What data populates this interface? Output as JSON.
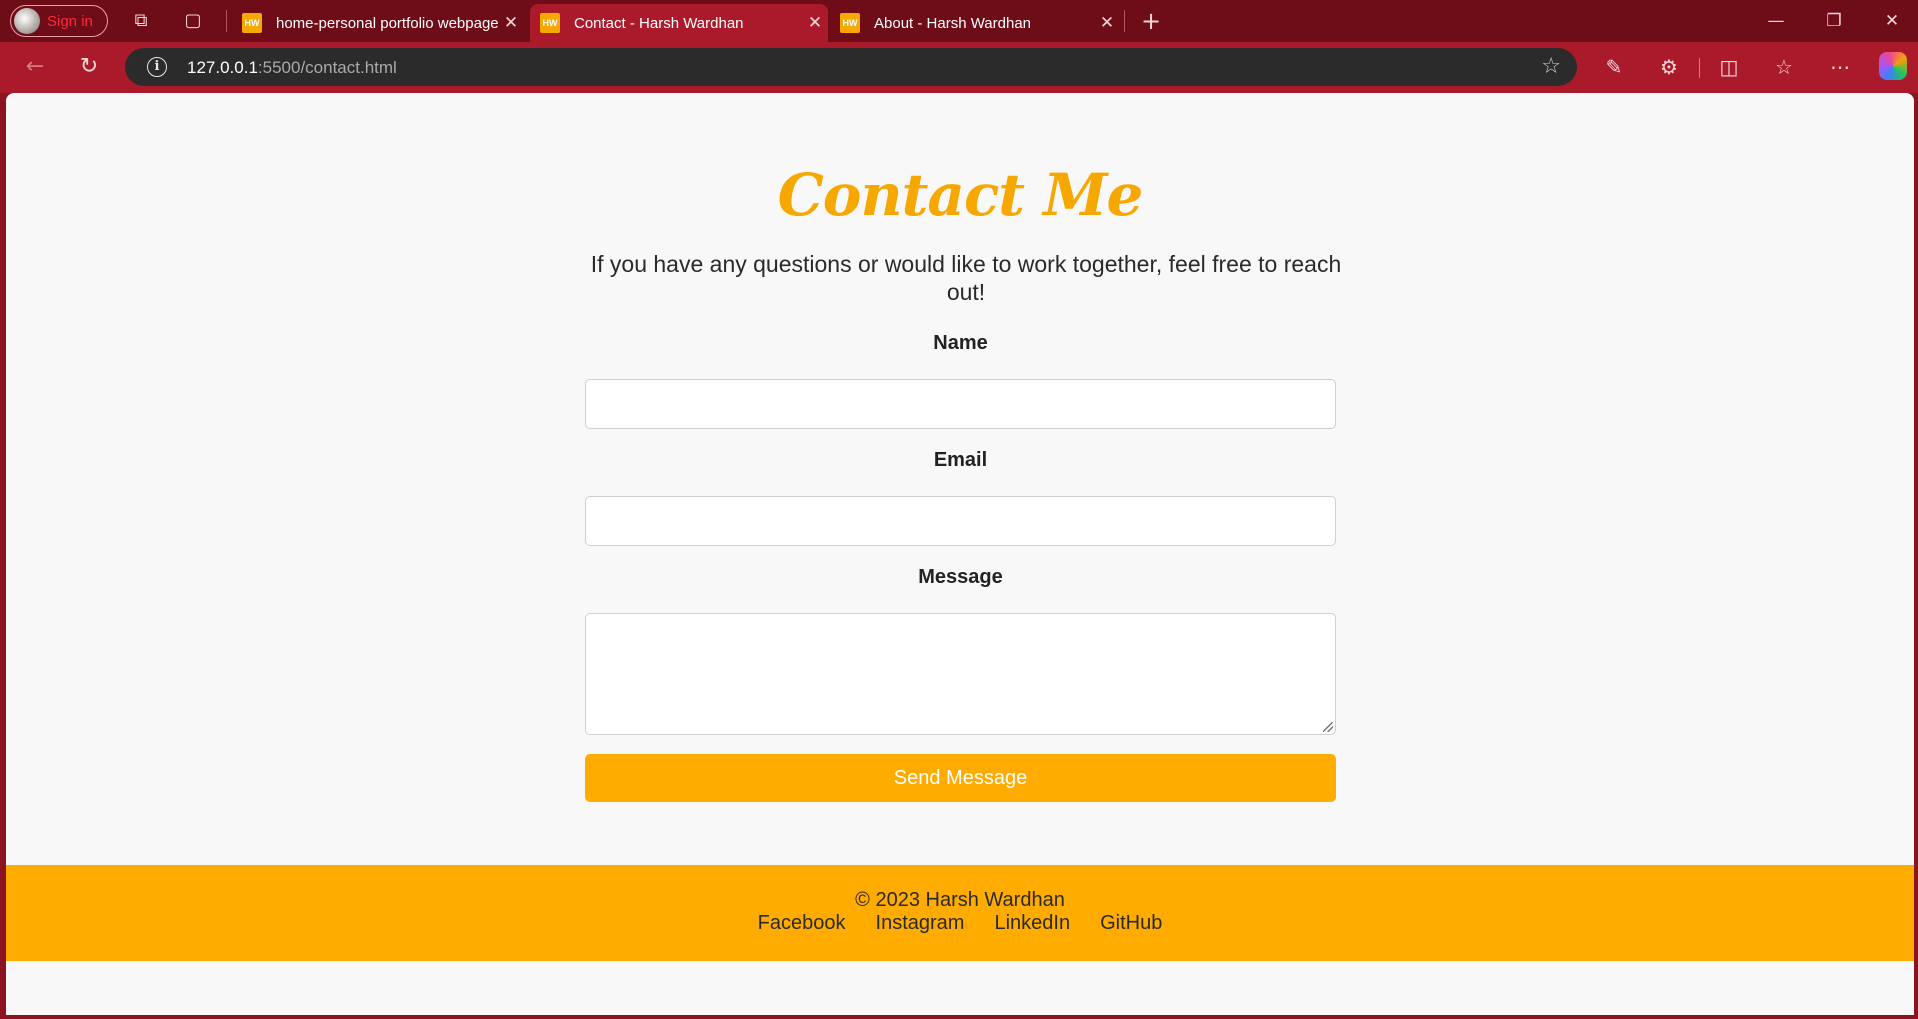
{
  "browser": {
    "profile": {
      "label": "Sign in"
    },
    "tabs": [
      {
        "favicon": "HW",
        "title": "home-personal portfolio webpage",
        "active": false
      },
      {
        "favicon": "HW",
        "title": "Contact - Harsh Wardhan",
        "active": true
      },
      {
        "favicon": "HW",
        "title": "About - Harsh Wardhan",
        "active": false
      }
    ],
    "address": {
      "host": "127.0.0.1",
      "rest": ":5500/contact.html"
    },
    "icons": [
      "workspaces-icon",
      "tab-actions-icon",
      "new-tab-icon",
      "back-icon",
      "refresh-icon",
      "site-info-icon",
      "favorite-star-icon",
      "eyedropper-icon",
      "extensions-icon",
      "split-screen-icon",
      "favorites-icon",
      "more-icon",
      "copilot-icon",
      "minimize-icon",
      "restore-icon",
      "close-window-icon"
    ],
    "accent_color": "#ab1a2b"
  },
  "page": {
    "heading": "Contact Me",
    "intro": "If you have any questions or would like to work together, feel free to reach out!",
    "form": {
      "name_label": "Name",
      "name_value": "",
      "email_label": "Email",
      "email_value": "",
      "message_label": "Message",
      "message_value": "",
      "submit_label": "Send Message"
    },
    "footer": {
      "copyright": "© 2023 Harsh Wardhan",
      "links": [
        "Facebook",
        "Instagram",
        "LinkedIn",
        "GitHub"
      ]
    },
    "colors": {
      "accent": "#ffab00",
      "heading": "#f6a800",
      "background": "#f8f8f8"
    }
  }
}
